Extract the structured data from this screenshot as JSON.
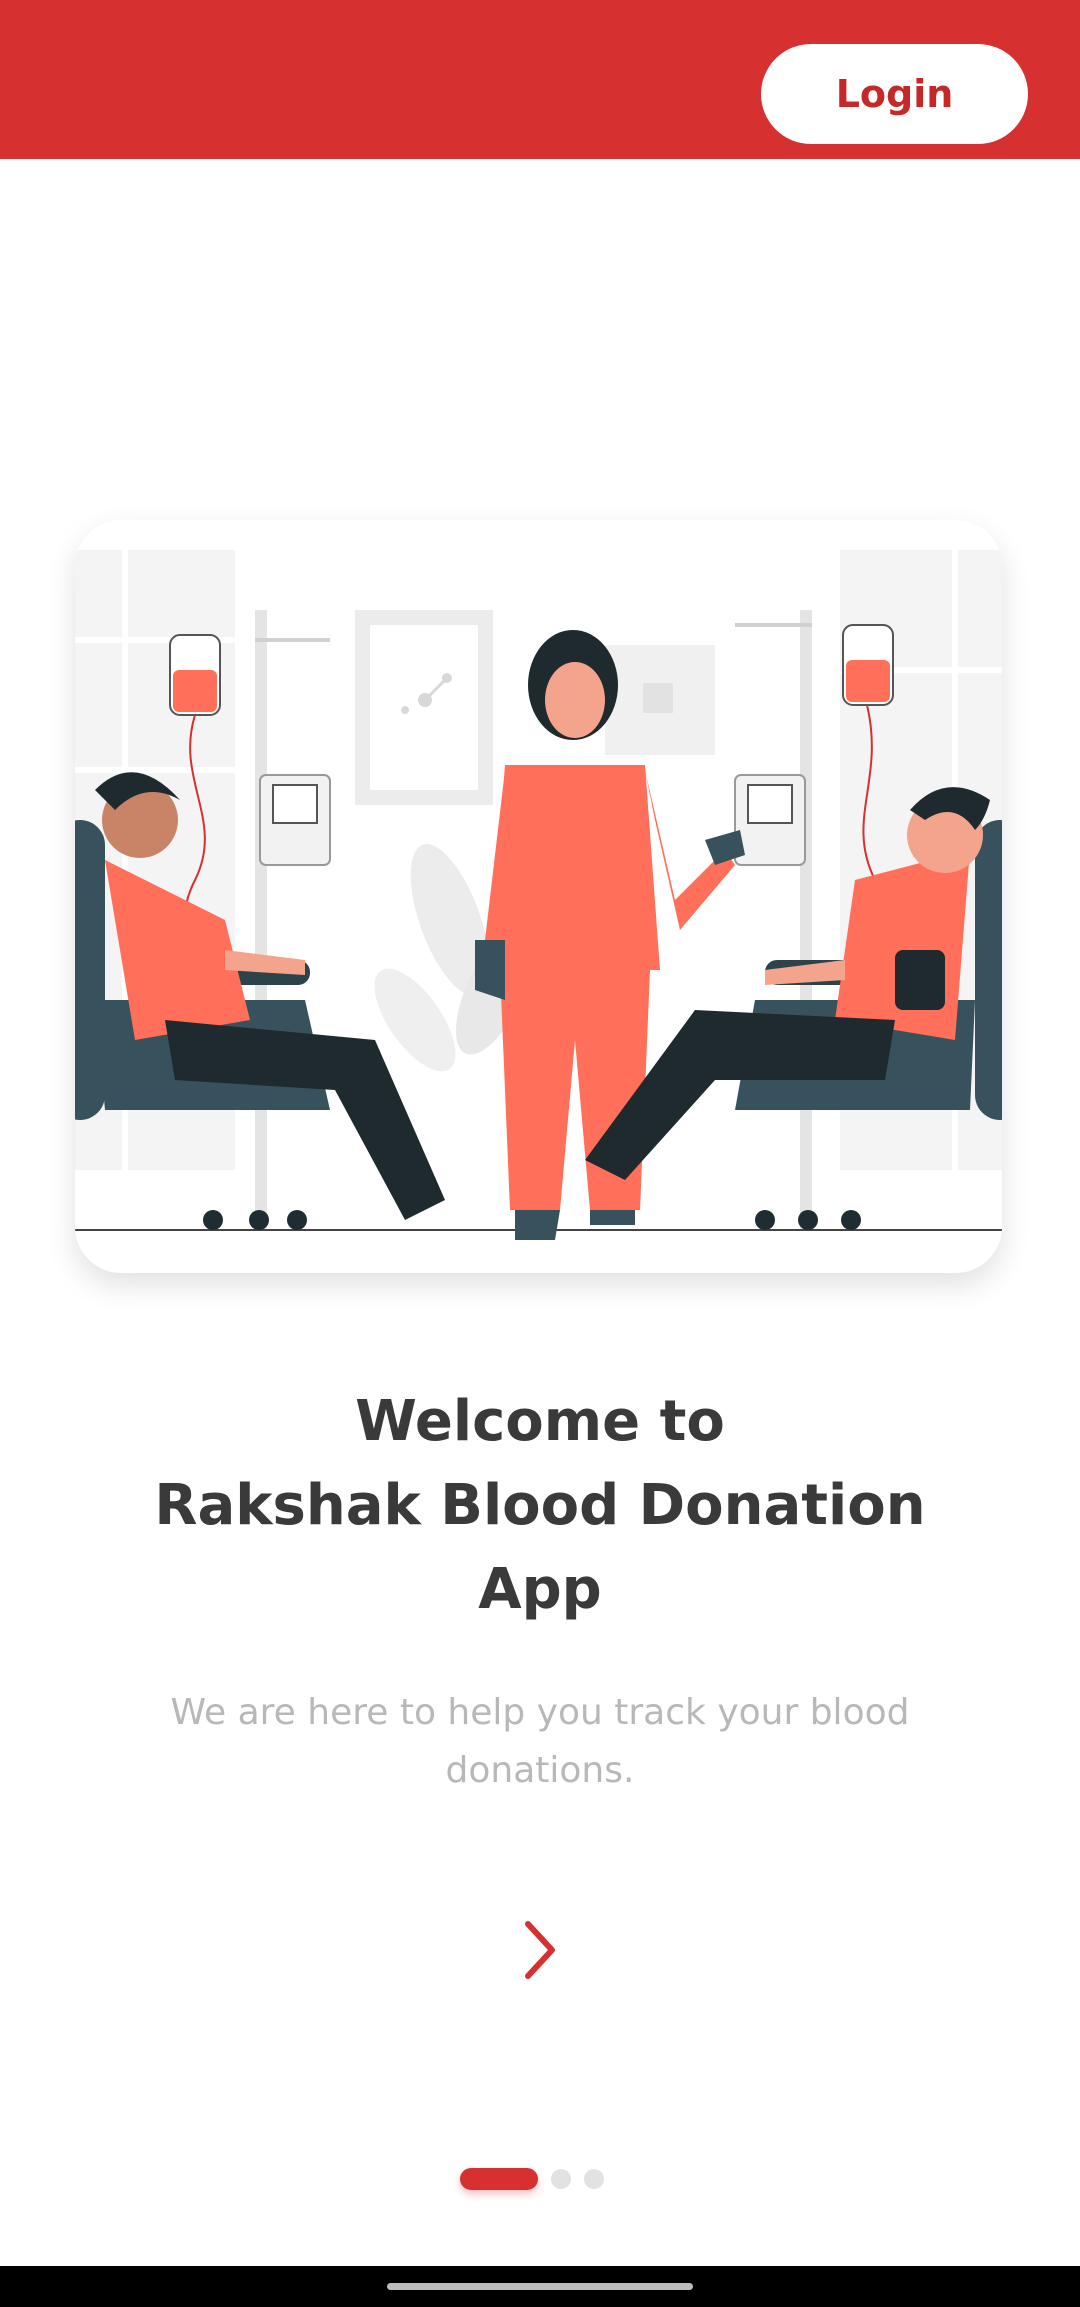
{
  "header": {
    "login_label": "Login"
  },
  "welcome": {
    "title_lines": [
      "Welcome to",
      "Rakshak Blood Donation",
      "App"
    ],
    "subtitle": "We are here to help you track your blood donations."
  },
  "illustration": {
    "name": "blood-donation-illustration"
  },
  "pager": {
    "current_page": 1,
    "total_pages": 3
  },
  "icons": {
    "next": "chevron-right-icon"
  },
  "colors": {
    "brand_red": "#d63031",
    "illustration_coral": "#ff6f59",
    "text_dark": "#3a3a3a",
    "text_muted": "#b8b8b8"
  }
}
